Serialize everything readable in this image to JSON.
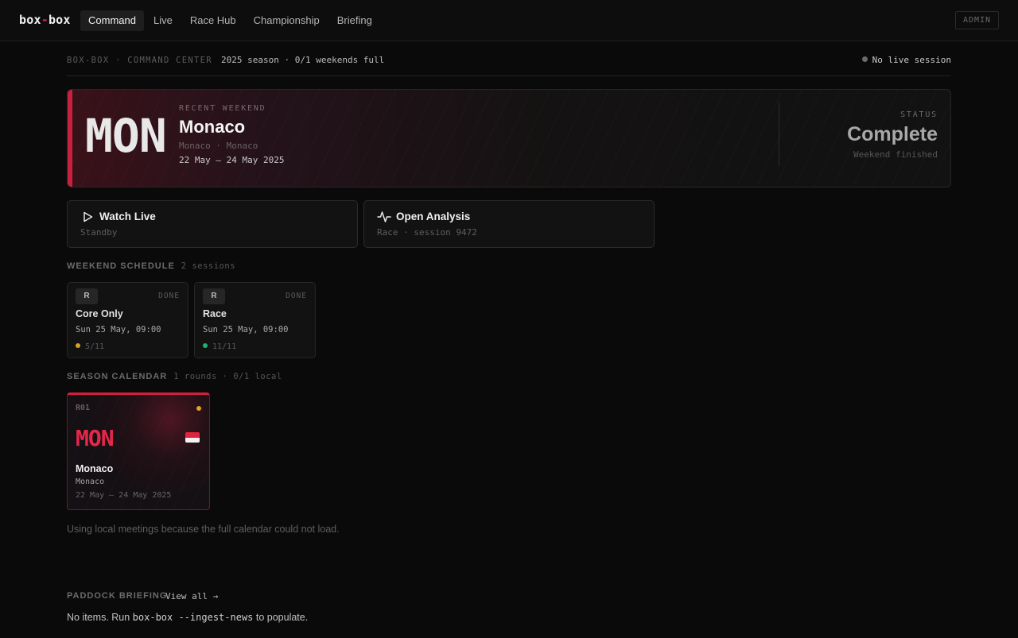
{
  "app": {
    "logo_left": "box",
    "logo_sep": "-",
    "logo_right": "box"
  },
  "nav": {
    "items": [
      {
        "label": "Command",
        "active": true
      },
      {
        "label": "Live",
        "active": false
      },
      {
        "label": "Race Hub",
        "active": false
      },
      {
        "label": "Championship",
        "active": false
      },
      {
        "label": "Briefing",
        "active": false
      }
    ],
    "admin_label": "ADMIN"
  },
  "header": {
    "breadcrumb": "BOX-BOX · COMMAND CENTER",
    "season_summary": "2025 season · 0/1 weekends full",
    "live_status": "No live session"
  },
  "hero": {
    "code": "MON",
    "kicker": "RECENT WEEKEND",
    "name": "Monaco",
    "location": "Monaco · Monaco",
    "dates": "22 May – 24 May 2025",
    "status_label": "STATUS",
    "status_value": "Complete",
    "status_sub": "Weekend finished",
    "accent_color": "#c8213f"
  },
  "actions": [
    {
      "title": "Watch Live",
      "sub": "Standby",
      "icon": "play-icon"
    },
    {
      "title": "Open Analysis",
      "sub": "Race · session 9472",
      "icon": "pulse-icon"
    }
  ],
  "schedule": {
    "title": "WEEKEND SCHEDULE",
    "meta": "2 sessions",
    "sessions": [
      {
        "badge": "R",
        "state": "DONE",
        "name": "Core Only",
        "time": "Sun 25 May, 09:00",
        "count": "5/11",
        "dot_color": "#d9a020"
      },
      {
        "badge": "R",
        "state": "DONE",
        "name": "Race",
        "time": "Sun 25 May, 09:00",
        "count": "11/11",
        "dot_color": "#22b070"
      }
    ]
  },
  "calendar": {
    "title": "SEASON CALENDAR",
    "meta": "1 rounds · 0/1 local",
    "rounds": [
      {
        "round": "R01",
        "code": "MON",
        "name": "Monaco",
        "location": "Monaco",
        "dates": "22 May – 24 May 2025",
        "flag_icon": "monaco-flag-icon",
        "dot_color": "#e7a020"
      }
    ],
    "note": "Using local meetings because the full calendar could not load."
  },
  "briefing": {
    "title": "PADDOCK BRIEFING",
    "view_all": "View all →",
    "empty_prefix": "No items. Run ",
    "empty_cmd": "box-box --ingest-news",
    "empty_suffix": " to populate."
  }
}
